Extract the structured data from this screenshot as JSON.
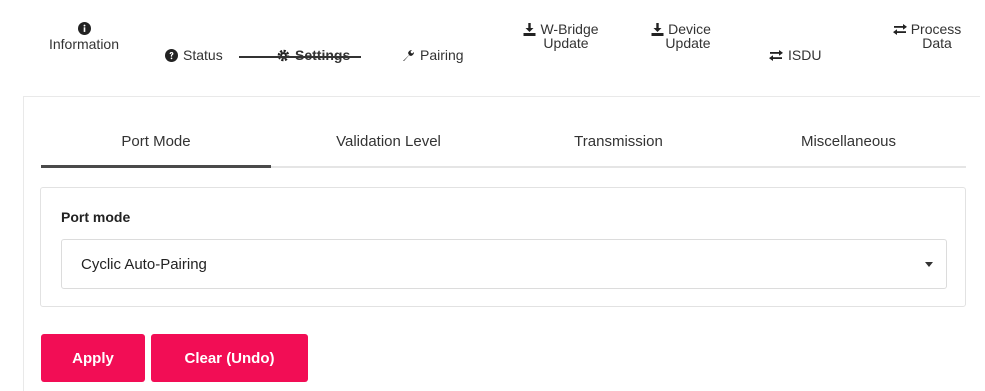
{
  "top_nav": {
    "information": "Information",
    "status": "Status",
    "settings": "Settings",
    "pairing": "Pairing",
    "wbridge_update_line1": "W-Bridge",
    "wbridge_update_line2": "Update",
    "device_update_line1": "Device",
    "device_update_line2": "Update",
    "isdu": "ISDU",
    "process_data_line1": "Process",
    "process_data_line2": "Data",
    "active": "Settings"
  },
  "sub_tabs": {
    "port_mode": "Port Mode",
    "validation_level": "Validation Level",
    "transmission": "Transmission",
    "miscellaneous": "Miscellaneous",
    "active": "Port Mode"
  },
  "port_mode_panel": {
    "label": "Port mode",
    "selected_value": "Cyclic Auto-Pairing"
  },
  "actions": {
    "apply": "Apply",
    "clear": "Clear (Undo)"
  },
  "colors": {
    "accent": "#f20d55",
    "text": "#333333",
    "border": "#e2e2e2"
  }
}
